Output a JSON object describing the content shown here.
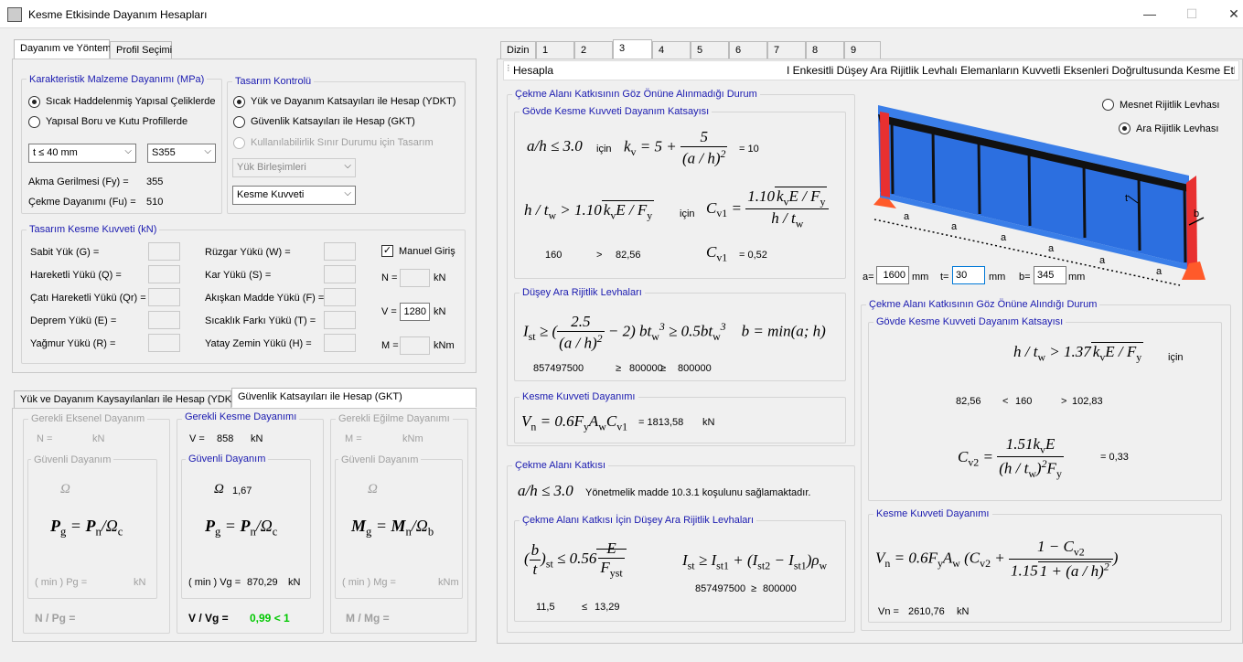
{
  "window": {
    "title": "Kesme Etkisinde Dayanım Hesapları",
    "min": "—",
    "max": "☐",
    "close": "✕"
  },
  "left_tabs": [
    "Dayanım ve Yöntem",
    "Profil Seçimi"
  ],
  "material": {
    "legend": "Karakteristik Malzeme Dayanımı (MPa)",
    "opt1": "Sıcak Haddelenmiş Yapısal Çeliklerde",
    "opt2": "Yapısal Boru ve Kutu Profillerde",
    "thickness": "t ≤ 40 mm",
    "grade": "S355",
    "fy_label": "Akma Gerilmesi (Fy) =",
    "fy": "355",
    "fu_label": "Çekme Dayanımı (Fu) =",
    "fu": "510"
  },
  "design": {
    "legend": "Tasarım Kontrolü",
    "opt1": "Yük ve Dayanım Katsayıları ile Hesap (YDKT)",
    "opt2": "Güvenlik Katsayıları ile Hesap (GKT)",
    "opt3": "Kullanılabilirlik Sınır Durumu için Tasarım",
    "combo1": "Yük Birleşimleri",
    "combo2": "Kesme Kuvveti"
  },
  "loads": {
    "legend": "Tasarım Kesme Kuvveti (kN)",
    "left": [
      "Sabit Yük (G) =",
      "Hareketli Yükü (Q) =",
      "Çatı Hareketli Yükü (Qr) =",
      "Deprem Yükü (E) =",
      "Yağmur Yükü (R) ="
    ],
    "right": [
      "Rüzgar Yükü (W) =",
      "Kar Yükü (S) =",
      "Akışkan Madde Yükü (F) =",
      "Sıcaklık Farkı Yükü (T) =",
      "Yatay Zemin Yükü (H) ="
    ],
    "manual": "Manuel Giriş",
    "n_label": "N =",
    "v_label": "V =",
    "m_label": "M =",
    "v_value": "1280",
    "kn": "kN",
    "knm": "kNm"
  },
  "bottom_tabs": [
    "Yük ve Dayanım Kaysayılanları ile Hesap (YDKT)",
    "Güvenlik Katsayıları ile Hesap (GKT)"
  ],
  "gkt": {
    "axial": {
      "legend": "Gerekli Eksenel Dayanım",
      "req": "N =",
      "unit": "kN",
      "safe": "Güvenli Dayanım",
      "omega": "Ω",
      "res": "( min ) Pg =",
      "res_unit": "kN",
      "ratio": "N / Pg ="
    },
    "shear": {
      "legend": "Gerekli Kesme Dayanımı",
      "req": "V =",
      "req_val": "858",
      "unit": "kN",
      "safe": "Güvenli Dayanım",
      "omega": "Ω",
      "omega_val": "1,67",
      "res": "( min ) Vg =",
      "res_val": "870,29",
      "res_unit": "kN",
      "ratio": "V / Vg =",
      "ratio_val": "0,99 < 1"
    },
    "bend": {
      "legend": "Gerekli Eğilme Dayanımı",
      "req": "M =",
      "unit": "kNm",
      "safe": "Güvenli Dayanım",
      "omega": "Ω",
      "res": "( min ) Mg =",
      "res_unit": "kNm",
      "ratio": "M / Mg ="
    }
  },
  "right_tabs": [
    "Dizin",
    "1",
    "2",
    "3",
    "4",
    "5",
    "6",
    "7",
    "8",
    "9"
  ],
  "hesapla": "Hesapla",
  "heading": "I Enkesitli Düşey Ara Rijitlik Levhalı Elemanların Kuvvetli Eksenleri Doğrultusunda Kesme Etkisi",
  "sec1": {
    "legend": "Çekme Alanı Katkısının Göz Önüne Alınmadığı Durum",
    "web": "Gövde Kesme Kuvveti Dayanım Katsayısı",
    "icin": "için",
    "kv": "= 10",
    "htw": "160",
    "gt": ">",
    "lim": "82,56",
    "cv1": "= 0,52",
    "stiff": "Düşey Ara Rijitlik Levhaları",
    "ist": "857497500",
    "ge": "≥",
    "req1": "800000",
    "req2": "800000",
    "shear": "Kesme Kuvveti Dayanımı",
    "vn": "= 1813,58",
    "kn": "kN"
  },
  "sec2": {
    "legend": "Çekme Alanı Katkısı",
    "note": "Yönetmelik madde 10.3.1 koşulunu sağlamaktadır.",
    "stiff": "Çekme Alanı Katkısı İçin Düşey Ara Rijitlik Levhaları",
    "bt": "11,5",
    "le": "≤",
    "lim": "13,29",
    "ist": "857497500",
    "ge": "≥",
    "req": "800000"
  },
  "sec3": {
    "legend": "Çekme Alanı Katkısının Göz Önüne Alındığı Durum",
    "web": "Gövde Kesme Kuvveti Dayanım Katsayısı",
    "icin": "için",
    "v1": "82,56",
    "lt": "<",
    "v2": "160",
    "gt": ">",
    "v3": "102,83",
    "cv2": "= 0,33",
    "shear": "Kesme Kuvveti Dayanımı",
    "vn_label": "Vn =",
    "vn": "2610,76",
    "kn": "kN"
  },
  "drawing": {
    "opt1": "Mesnet Rijitlik Levhası",
    "opt2": "Ara Rijitlik Levhası",
    "a_lbl": "a=",
    "a": "1600",
    "t_lbl": "t=",
    "t": "30",
    "b_lbl": "b=",
    "b": "345",
    "mm": "mm",
    "dim_a": "a",
    "dim_t": "t",
    "dim_b": "b"
  }
}
